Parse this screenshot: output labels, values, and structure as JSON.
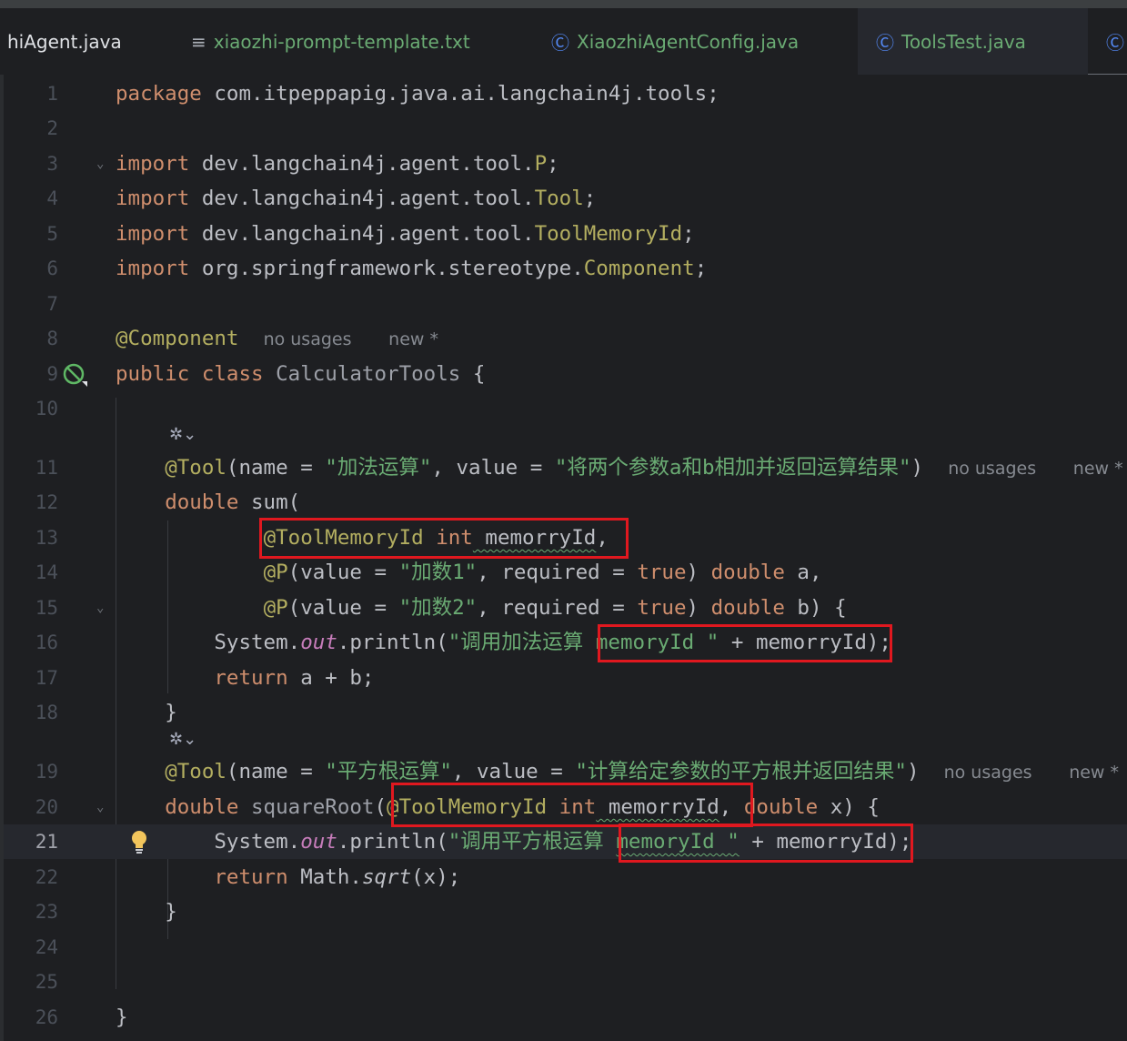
{
  "tabs": [
    {
      "label": "hiAgent.java",
      "icon": "java-file-icon"
    },
    {
      "label": "xiaozhi-prompt-template.txt",
      "icon": "text-file-icon"
    },
    {
      "label": "XiaozhiAgentConfig.java",
      "icon": "java-class-icon"
    },
    {
      "label": "ToolsTest.java",
      "icon": "java-test-class-icon"
    }
  ],
  "hints": {
    "no_usages": "no usages",
    "new": "new *"
  },
  "line_numbers": [
    "1",
    "2",
    "3",
    "4",
    "5",
    "6",
    "7",
    "8",
    "9",
    "10",
    "11",
    "12",
    "13",
    "14",
    "15",
    "16",
    "17",
    "18",
    "19",
    "20",
    "21",
    "22",
    "23",
    "24",
    "25",
    "26"
  ],
  "current_line": "21",
  "code": {
    "l1": {
      "kw": "package",
      "rest": " com.itpeppapig.java.ai.langchain4j.tools;"
    },
    "l3": {
      "kw": "import",
      "pkg": " dev.langchain4j.agent.tool.",
      "cls": "P",
      "end": ";"
    },
    "l4": {
      "kw": "import",
      "pkg": " dev.langchain4j.agent.tool.",
      "cls": "Tool",
      "end": ";"
    },
    "l5": {
      "kw": "import",
      "pkg": " dev.langchain4j.agent.tool.",
      "cls": "ToolMemoryId",
      "end": ";"
    },
    "l6": {
      "kw": "import",
      "pkg": " org.springframework.stereotype.",
      "cls": "Component",
      "end": ";"
    },
    "l8": {
      "ann": "@Component"
    },
    "l9": {
      "kw1": "public",
      "kw2": "class",
      "cls": "CalculatorTools",
      "end": " {"
    },
    "l11": {
      "ann": "@Tool",
      "p1": "(name = ",
      "s1": "\"加法运算\"",
      "p2": ", value = ",
      "s2": "\"将两个参数a和b相加并返回运算结果\"",
      "p3": ")"
    },
    "l12": {
      "kw": "double",
      "fn": " sum",
      "end": "("
    },
    "l13": {
      "ann": "@ToolMemoryId",
      "kw": " int",
      "var": " memorryId",
      "end": ","
    },
    "l14": {
      "ann": "@P",
      "p1": "(value = ",
      "s1": "\"加数1\"",
      "p2": ", required = ",
      "kw1": "true",
      "p3": ") ",
      "kw2": "double",
      "end": " a,"
    },
    "l15": {
      "ann": "@P",
      "p1": "(value = ",
      "s1": "\"加数2\"",
      "p2": ", required = ",
      "kw1": "true",
      "p3": ") ",
      "kw2": "double",
      "end": " b) {"
    },
    "l16": {
      "cls": "System.",
      "fld": "out",
      "m": ".println(",
      "s1": "\"调用加法运算 ",
      "s2": "memoryId \"",
      "p": " + memorryId",
      "end": ");"
    },
    "l17": {
      "kw": "return",
      "end": " a + b;"
    },
    "l18": {
      "end": "}"
    },
    "l19": {
      "ann": "@Tool",
      "p1": "(name = ",
      "s1": "\"平方根运算\"",
      "p2": ", value = ",
      "s2": "\"计算给定参数的平方根并返回结果\"",
      "p3": ")"
    },
    "l20": {
      "kw": "double",
      "fn": " squareRoot",
      "p1": "(",
      "ann": "@ToolMemoryId",
      "kw2": " int",
      "var": " memorryId",
      "p2": ", ",
      "kw3": "double",
      "end": " x) {"
    },
    "l21": {
      "cls": "System.",
      "fld": "out",
      "m": ".println(",
      "s1": "\"调用平方根运算 ",
      "s2": "memoryId \"",
      "p": " + memorryId",
      "end": ");"
    },
    "l22": {
      "kw": "return",
      "cls": " Math.",
      "fn": "sqrt",
      "end": "(x);"
    },
    "l23": {
      "end": "}"
    },
    "l26": {
      "end": "}"
    }
  }
}
